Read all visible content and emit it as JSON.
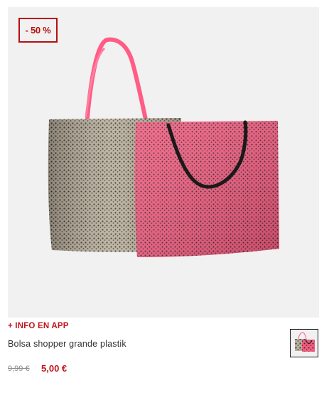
{
  "product": {
    "discount_badge": "- 50 %",
    "info_link": "+ INFO EN APP",
    "name": "Bolsa shopper grande plastik",
    "price_old": "9,99 €",
    "price_new": "5,00 €",
    "image_icon": "tote-bags-photo",
    "thumbnail_icon": "tote-bags-thumbnail"
  },
  "colors": {
    "accent_red": "#c0151b",
    "badge_red": "#b70f0f",
    "image_background": "#f1f1f1",
    "bag_beige": "#a89d8c",
    "bag_pink": "#f0587a",
    "handle_pink": "#ff5c86",
    "handle_black": "#1a1a1a"
  }
}
